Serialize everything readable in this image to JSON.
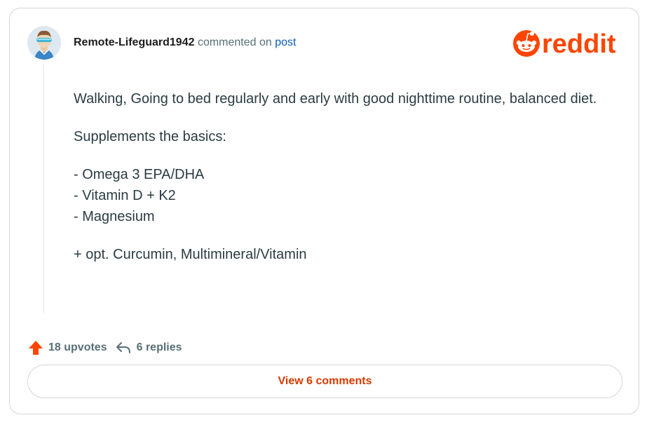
{
  "comment": {
    "author": "Remote-Lifeguard1942",
    "commented_on": "commented on",
    "post_link": "post",
    "body": {
      "p1": "Walking, Going to bed regularly and early with good nighttime routine, balanced diet.",
      "p2": "Supplements the basics:",
      "list": [
        "- Omega 3 EPA/DHA",
        "- Vitamin D + K2",
        "- Magnesium"
      ],
      "p3": "+ opt. Curcumin, Multimineral/Vitamin"
    },
    "upvotes": "18 upvotes",
    "replies": "6 replies"
  },
  "brand": {
    "logo_text": "reddit",
    "color": "#ff4500"
  },
  "view_comments": "View 6 comments",
  "icons": [
    "avatar",
    "reddit-logo-icon",
    "upvote-arrow-icon",
    "reply-arrow-icon"
  ],
  "colors": {
    "accent": "#ff4500",
    "link": "#0a5bb5",
    "button_text": "#d93a00",
    "muted": "#576f76"
  }
}
